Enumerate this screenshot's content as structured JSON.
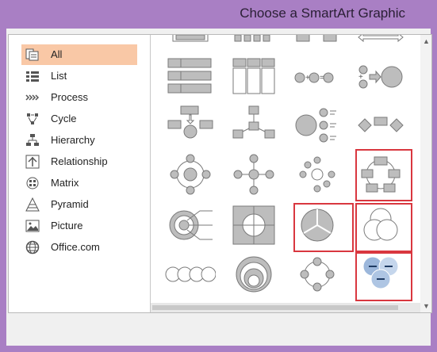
{
  "window": {
    "title": "Choose a SmartArt Graphic"
  },
  "categories": [
    {
      "label": "All",
      "icon": "all-icon",
      "selected": true
    },
    {
      "label": "List",
      "icon": "list-icon"
    },
    {
      "label": "Process",
      "icon": "process-icon"
    },
    {
      "label": "Cycle",
      "icon": "cycle-icon"
    },
    {
      "label": "Hierarchy",
      "icon": "hierarchy-icon"
    },
    {
      "label": "Relationship",
      "icon": "relationship-icon"
    },
    {
      "label": "Matrix",
      "icon": "matrix-icon"
    },
    {
      "label": "Pyramid",
      "icon": "pyramid-icon"
    },
    {
      "label": "Picture",
      "icon": "picture-icon"
    },
    {
      "label": "Office.com",
      "icon": "globe-icon"
    }
  ],
  "colors": {
    "selected_category": "#f9c8a6",
    "highlight_box": "#d9373f",
    "window_frame": "#a97fc4"
  }
}
